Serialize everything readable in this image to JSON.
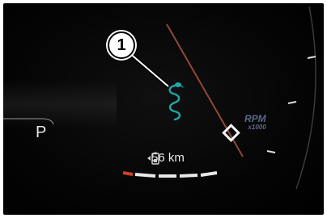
{
  "cluster": {
    "gear": "P",
    "range_value": "56 km",
    "callout_number": "1",
    "tach_label": "RPM",
    "tach_unit": "x1000",
    "warning_symbol": "mamba-snake-icon",
    "colors": {
      "background": "#000000",
      "symbol": "#1fa7a7",
      "needle": "#d98060",
      "tach_label": "#5b6a88",
      "scale": "#e0e0e0",
      "redline": "#d0402a"
    }
  }
}
